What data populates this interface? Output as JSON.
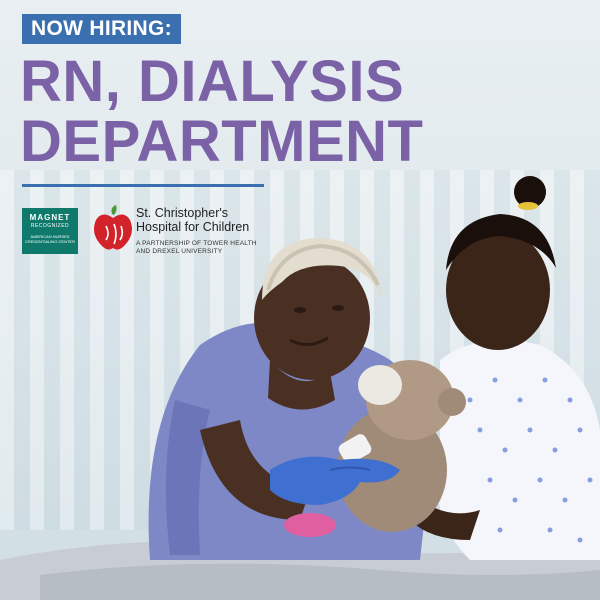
{
  "badge": "NOW HIRING:",
  "headline": {
    "line1": "RN, DIALYSIS",
    "line2": "DEPARTMENT"
  },
  "magnet": {
    "line1": "MAGNET",
    "line2": "RECOGNIZED",
    "line3": "AMERICAN NURSES CREDENTIALING CENTER"
  },
  "hospital": {
    "name_line1": "St. Christopher's",
    "name_line2": "Hospital for Children",
    "tag_line1": "A PARTNERSHIP OF TOWER HEALTH",
    "tag_line2": "AND DREXEL UNIVERSITY"
  },
  "colors": {
    "headline": "#7b62a6",
    "badge": "#3a6fb0",
    "magnet": "#0f7a6c",
    "scrubs": "#7e88c7",
    "glove": "#3f6fd0"
  }
}
